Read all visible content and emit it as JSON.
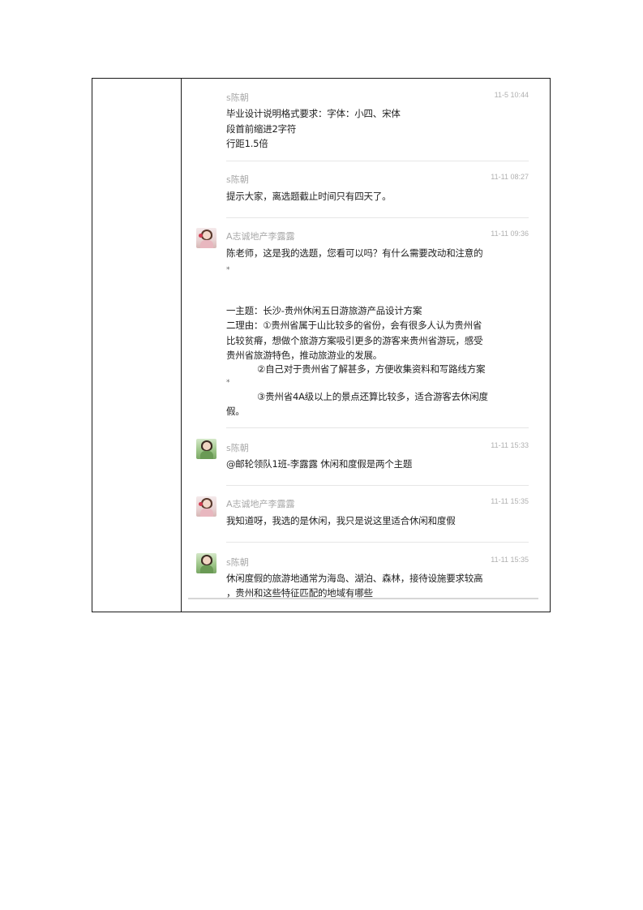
{
  "messages": [
    {
      "sender": "s陈朝",
      "time": "11-5 10:44",
      "avatar": "none",
      "lines": [
        "毕业设计说明格式要求：字体：小四、宋体",
        "段首前缩进2字符",
        "行距1.5倍"
      ]
    },
    {
      "sender": "s陈朝",
      "time": "11-11 08:27",
      "avatar": "none",
      "lines": [
        "提示大家，离选题截止时间只有四天了。"
      ]
    },
    {
      "sender": "A志诚地产李露露",
      "time": "11-11 09:36",
      "avatar": "girl-portrait-icon",
      "lines": [
        "陈老师，这是我的选题，您看可以吗？有什么需要改动和注意的",
        "*",
        "一主题：长沙-贵州休闲五日游旅游产品设计方案",
        "二理由：①贵州省属于山比较多的省份，会有很多人认为贵州省",
        "比较贫瘠，想做个旅游方案吸引更多的游客来贵州省游玩，感受",
        "贵州省旅游特色，推动旅游业的发展。",
        "②自己对于贵州省了解甚多，方便收集资料和写路线方案",
        "*",
        "③贵州省4A级以上的景点还算比较多，适合游客去休闲度",
        "假。"
      ]
    },
    {
      "sender": "s陈朝",
      "time": "11-11 15:33",
      "avatar": "plant-portrait-icon",
      "lines": [
        "@邮轮领队1班-李露露 休闲和度假是两个主题"
      ]
    },
    {
      "sender": "A志诚地产李露露",
      "time": "11-11 15:35",
      "avatar": "girl-portrait-icon",
      "lines": [
        "我知道呀，我选的是休闲，我只是说这里适合休闲和度假"
      ]
    },
    {
      "sender": "s陈朝",
      "time": "11-11 15:35",
      "avatar": "plant-portrait-icon",
      "lines": [
        "休闲度假的旅游地通常为海岛、湖泊、森林，接待设施要求较高",
        "，贵州和这些特征匹配的地域有哪些"
      ]
    }
  ]
}
